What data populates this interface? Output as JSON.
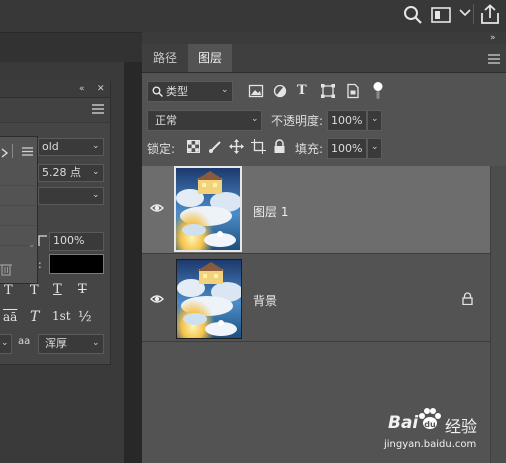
{
  "topbar": {
    "icons": [
      "search-icon",
      "workspace-icon",
      "chevron-down-icon",
      "share-icon"
    ]
  },
  "character_panel": {
    "font_style": "old",
    "font_size": "5.28 点",
    "vertical_scale": "100%",
    "anti_alias": "浑厚",
    "aa_label": "aa",
    "superscript": "1st",
    "fraction": "½",
    "small_caps": "aā"
  },
  "layers_panel": {
    "tabs": [
      {
        "label": "路径"
      },
      {
        "label": "图层"
      }
    ],
    "filter": {
      "label": "类型"
    },
    "blend_mode": "正常",
    "opacity_label": "不透明度:",
    "opacity_value": "100%",
    "lock_label": "锁定:",
    "fill_label": "填充:",
    "fill_value": "100%",
    "layers": [
      {
        "name": "图层 1",
        "selected": true,
        "locked": false
      },
      {
        "name": "背景",
        "selected": false,
        "locked": true
      }
    ]
  },
  "watermark": {
    "brand": "Bai",
    "brand2": "经验",
    "url": "jingyan.baidu.com"
  }
}
